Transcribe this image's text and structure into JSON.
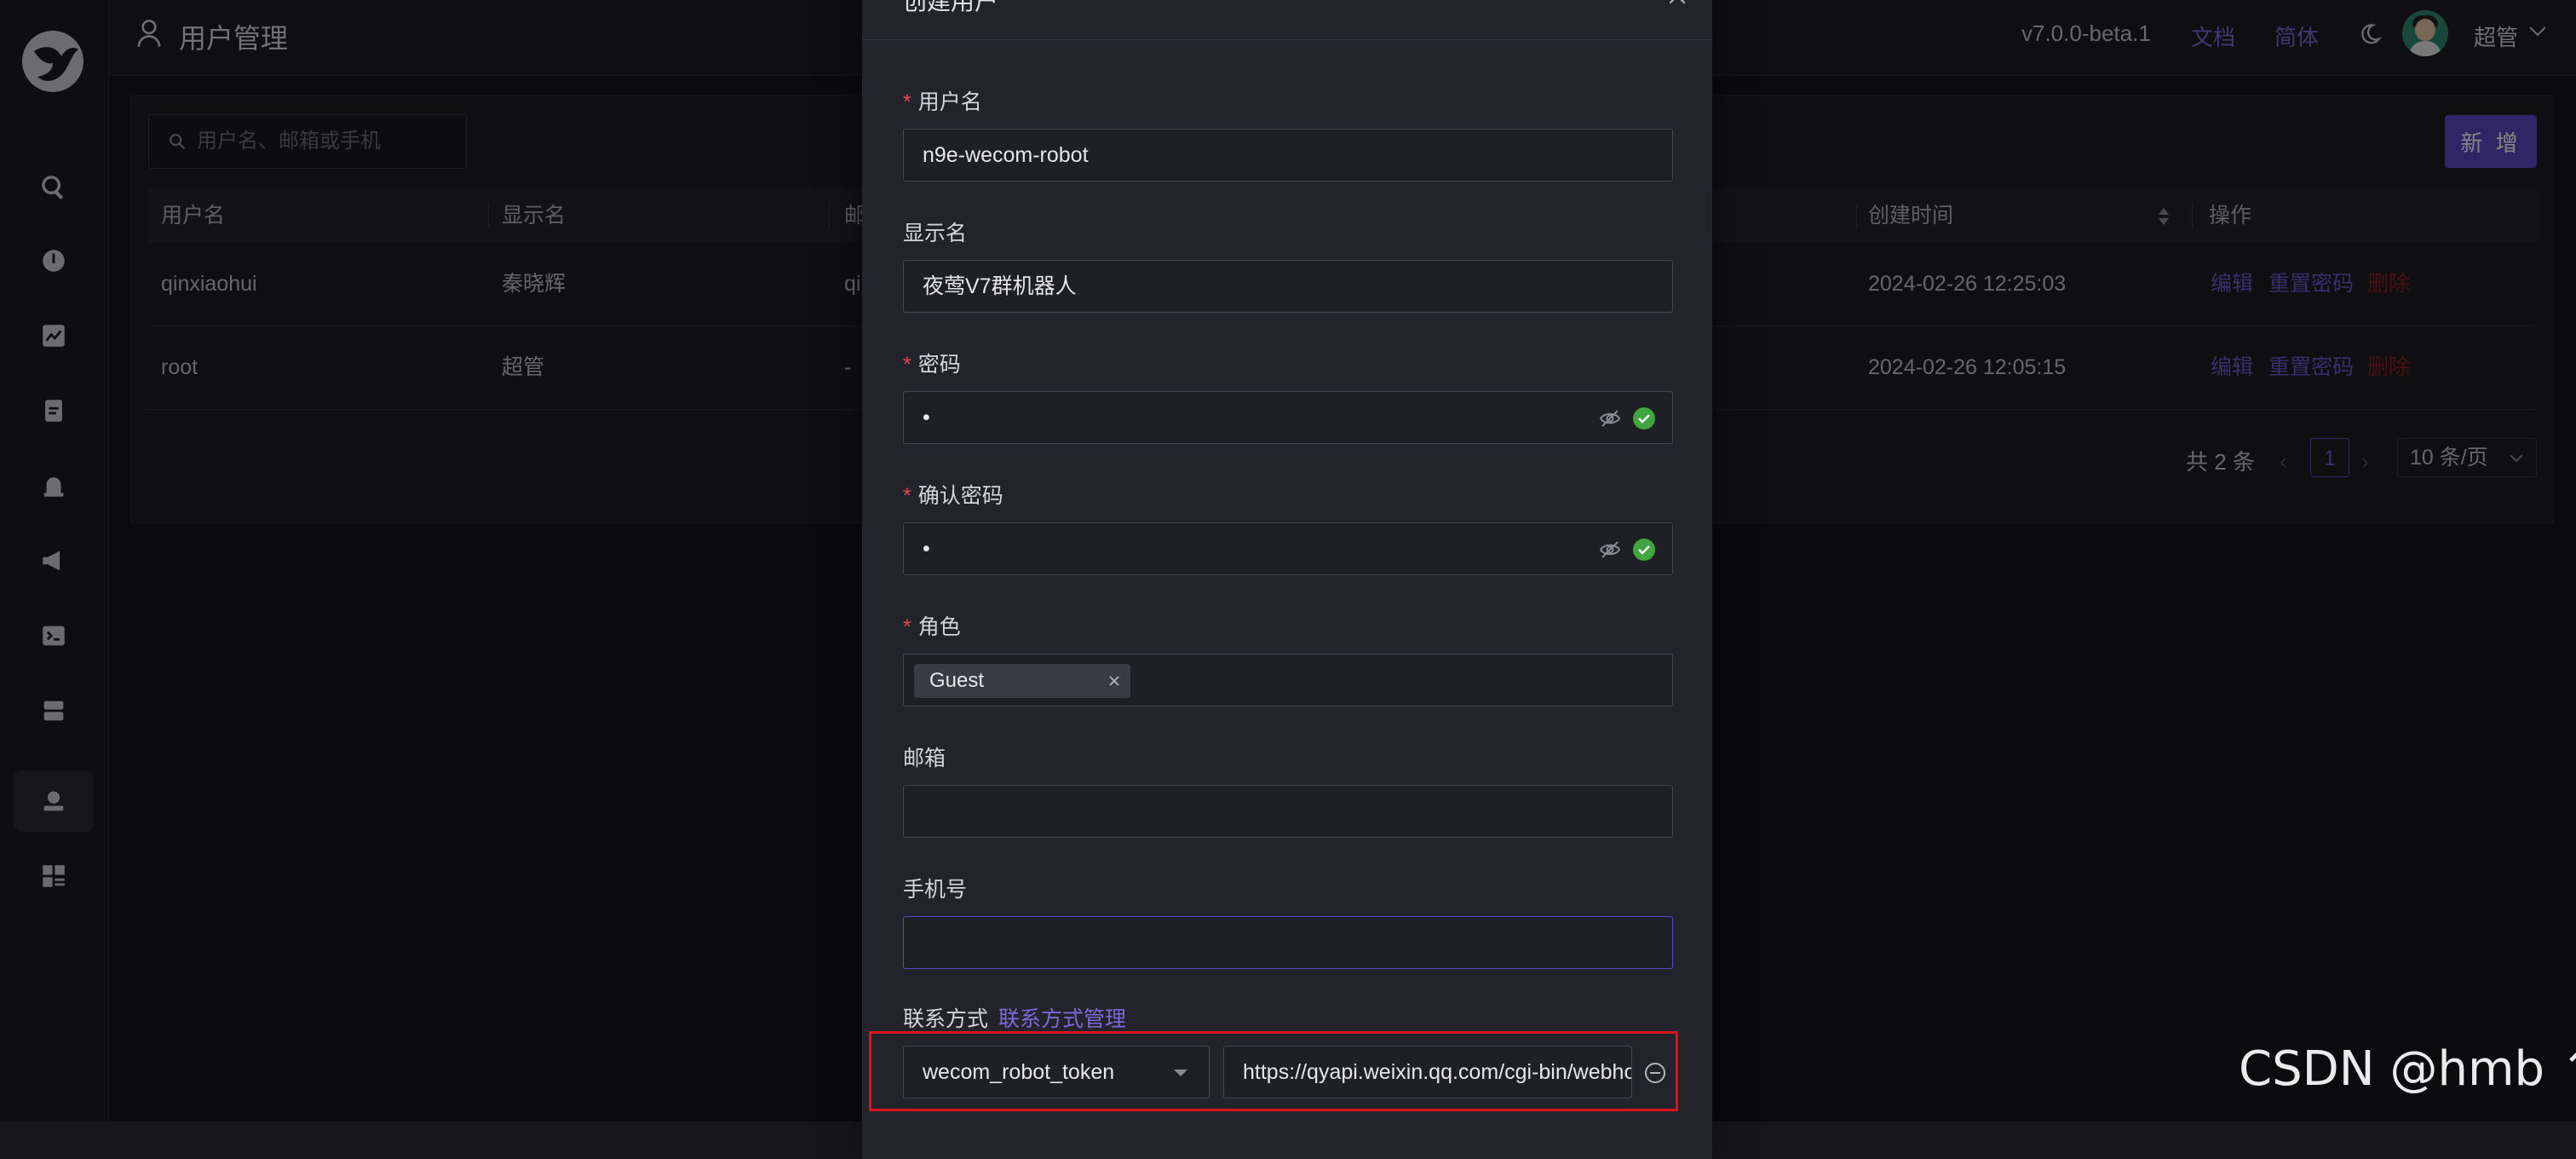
{
  "header": {
    "title": "用户管理",
    "version": "v7.0.0-beta.1",
    "doc_link": "文档",
    "lang_link": "简体",
    "username": "超管"
  },
  "sidebar": {
    "items": [
      {
        "icon": "search-icon"
      },
      {
        "icon": "alert-icon"
      },
      {
        "icon": "chart-icon"
      },
      {
        "icon": "log-icon"
      },
      {
        "icon": "alarm-bell-icon"
      },
      {
        "icon": "megaphone-icon"
      },
      {
        "icon": "terminal-icon"
      },
      {
        "icon": "server-icon"
      },
      {
        "icon": "user-management-icon",
        "active": true
      },
      {
        "icon": "dashboard-grid-icon"
      }
    ]
  },
  "toolbar": {
    "search_placeholder": "用户名、邮箱或手机",
    "add_label": "新 增"
  },
  "table": {
    "columns": [
      "用户名",
      "显示名",
      "邮",
      "创建时间",
      "操作"
    ],
    "rows": [
      {
        "username": "qinxiaohui",
        "display": "秦晓辉",
        "email": "qi",
        "created": "2024-02-26 12:25:03",
        "edit": "编辑",
        "reset": "重置密码",
        "delete": "删除"
      },
      {
        "username": "root",
        "display": "超管",
        "email": "-",
        "created": "2024-02-26 12:05:15",
        "edit": "编辑",
        "reset": "重置密码",
        "delete": "删除"
      }
    ]
  },
  "pagination": {
    "total": "共 2 条",
    "current": "1",
    "page_size": "10 条/页"
  },
  "modal": {
    "title": "创建用户",
    "fields": {
      "username": {
        "label": "用户名",
        "required": "*",
        "value": "n9e-wecom-robot"
      },
      "display_name": {
        "label": "显示名",
        "value": "夜莺V7群机器人"
      },
      "password": {
        "label": "密码",
        "required": "*",
        "value": "•"
      },
      "confirm_password": {
        "label": "确认密码",
        "required": "*",
        "value": "•"
      },
      "role": {
        "label": "角色",
        "required": "*",
        "tag": "Guest"
      },
      "email": {
        "label": "邮箱",
        "value": ""
      },
      "phone": {
        "label": "手机号",
        "value": ""
      },
      "contact": {
        "label": "联系方式",
        "manage_link": "联系方式管理",
        "type": "wecom_robot_token",
        "value": "https://qyapi.weixin.qq.com/cgi-bin/webhook/send"
      }
    }
  },
  "watermark": "CSDN @hmb ↑",
  "colors": {
    "accent": "#5c47c2",
    "link": "#7d68d8",
    "danger": "#8d1f28",
    "highlight_box": "#d9141c",
    "success": "#3fa53f"
  }
}
